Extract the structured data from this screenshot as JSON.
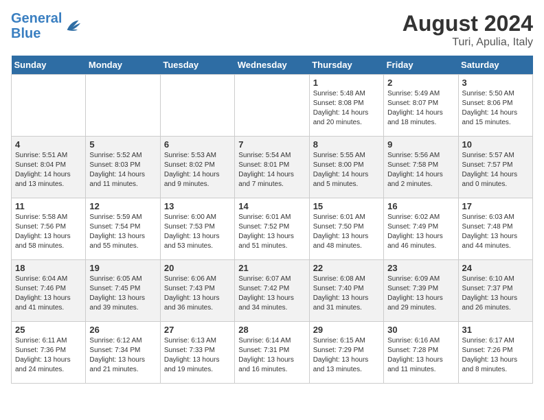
{
  "logo": {
    "line1": "General",
    "line2": "Blue"
  },
  "title": "August 2024",
  "subtitle": "Turi, Apulia, Italy",
  "weekdays": [
    "Sunday",
    "Monday",
    "Tuesday",
    "Wednesday",
    "Thursday",
    "Friday",
    "Saturday"
  ],
  "weeks": [
    [
      {
        "day": "",
        "info": ""
      },
      {
        "day": "",
        "info": ""
      },
      {
        "day": "",
        "info": ""
      },
      {
        "day": "",
        "info": ""
      },
      {
        "day": "1",
        "info": "Sunrise: 5:48 AM\nSunset: 8:08 PM\nDaylight: 14 hours\nand 20 minutes."
      },
      {
        "day": "2",
        "info": "Sunrise: 5:49 AM\nSunset: 8:07 PM\nDaylight: 14 hours\nand 18 minutes."
      },
      {
        "day": "3",
        "info": "Sunrise: 5:50 AM\nSunset: 8:06 PM\nDaylight: 14 hours\nand 15 minutes."
      }
    ],
    [
      {
        "day": "4",
        "info": "Sunrise: 5:51 AM\nSunset: 8:04 PM\nDaylight: 14 hours\nand 13 minutes."
      },
      {
        "day": "5",
        "info": "Sunrise: 5:52 AM\nSunset: 8:03 PM\nDaylight: 14 hours\nand 11 minutes."
      },
      {
        "day": "6",
        "info": "Sunrise: 5:53 AM\nSunset: 8:02 PM\nDaylight: 14 hours\nand 9 minutes."
      },
      {
        "day": "7",
        "info": "Sunrise: 5:54 AM\nSunset: 8:01 PM\nDaylight: 14 hours\nand 7 minutes."
      },
      {
        "day": "8",
        "info": "Sunrise: 5:55 AM\nSunset: 8:00 PM\nDaylight: 14 hours\nand 5 minutes."
      },
      {
        "day": "9",
        "info": "Sunrise: 5:56 AM\nSunset: 7:58 PM\nDaylight: 14 hours\nand 2 minutes."
      },
      {
        "day": "10",
        "info": "Sunrise: 5:57 AM\nSunset: 7:57 PM\nDaylight: 14 hours\nand 0 minutes."
      }
    ],
    [
      {
        "day": "11",
        "info": "Sunrise: 5:58 AM\nSunset: 7:56 PM\nDaylight: 13 hours\nand 58 minutes."
      },
      {
        "day": "12",
        "info": "Sunrise: 5:59 AM\nSunset: 7:54 PM\nDaylight: 13 hours\nand 55 minutes."
      },
      {
        "day": "13",
        "info": "Sunrise: 6:00 AM\nSunset: 7:53 PM\nDaylight: 13 hours\nand 53 minutes."
      },
      {
        "day": "14",
        "info": "Sunrise: 6:01 AM\nSunset: 7:52 PM\nDaylight: 13 hours\nand 51 minutes."
      },
      {
        "day": "15",
        "info": "Sunrise: 6:01 AM\nSunset: 7:50 PM\nDaylight: 13 hours\nand 48 minutes."
      },
      {
        "day": "16",
        "info": "Sunrise: 6:02 AM\nSunset: 7:49 PM\nDaylight: 13 hours\nand 46 minutes."
      },
      {
        "day": "17",
        "info": "Sunrise: 6:03 AM\nSunset: 7:48 PM\nDaylight: 13 hours\nand 44 minutes."
      }
    ],
    [
      {
        "day": "18",
        "info": "Sunrise: 6:04 AM\nSunset: 7:46 PM\nDaylight: 13 hours\nand 41 minutes."
      },
      {
        "day": "19",
        "info": "Sunrise: 6:05 AM\nSunset: 7:45 PM\nDaylight: 13 hours\nand 39 minutes."
      },
      {
        "day": "20",
        "info": "Sunrise: 6:06 AM\nSunset: 7:43 PM\nDaylight: 13 hours\nand 36 minutes."
      },
      {
        "day": "21",
        "info": "Sunrise: 6:07 AM\nSunset: 7:42 PM\nDaylight: 13 hours\nand 34 minutes."
      },
      {
        "day": "22",
        "info": "Sunrise: 6:08 AM\nSunset: 7:40 PM\nDaylight: 13 hours\nand 31 minutes."
      },
      {
        "day": "23",
        "info": "Sunrise: 6:09 AM\nSunset: 7:39 PM\nDaylight: 13 hours\nand 29 minutes."
      },
      {
        "day": "24",
        "info": "Sunrise: 6:10 AM\nSunset: 7:37 PM\nDaylight: 13 hours\nand 26 minutes."
      }
    ],
    [
      {
        "day": "25",
        "info": "Sunrise: 6:11 AM\nSunset: 7:36 PM\nDaylight: 13 hours\nand 24 minutes."
      },
      {
        "day": "26",
        "info": "Sunrise: 6:12 AM\nSunset: 7:34 PM\nDaylight: 13 hours\nand 21 minutes."
      },
      {
        "day": "27",
        "info": "Sunrise: 6:13 AM\nSunset: 7:33 PM\nDaylight: 13 hours\nand 19 minutes."
      },
      {
        "day": "28",
        "info": "Sunrise: 6:14 AM\nSunset: 7:31 PM\nDaylight: 13 hours\nand 16 minutes."
      },
      {
        "day": "29",
        "info": "Sunrise: 6:15 AM\nSunset: 7:29 PM\nDaylight: 13 hours\nand 13 minutes."
      },
      {
        "day": "30",
        "info": "Sunrise: 6:16 AM\nSunset: 7:28 PM\nDaylight: 13 hours\nand 11 minutes."
      },
      {
        "day": "31",
        "info": "Sunrise: 6:17 AM\nSunset: 7:26 PM\nDaylight: 13 hours\nand 8 minutes."
      }
    ]
  ]
}
